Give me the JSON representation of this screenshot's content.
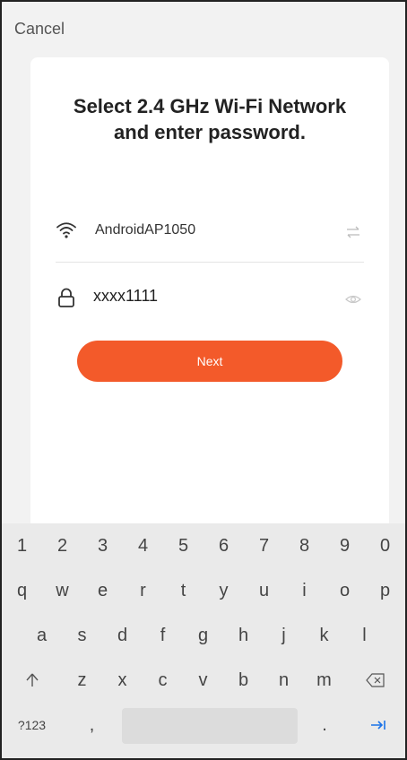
{
  "header": {
    "cancel_label": "Cancel"
  },
  "card": {
    "title": "Select 2.4 GHz Wi-Fi Network and enter password.",
    "network_name": "AndroidAP1050",
    "password_value": "xxxx1111",
    "next_label": "Next"
  },
  "colors": {
    "accent": "#f35a2a",
    "card_bg": "#ffffff",
    "keyboard_bg": "#eaeaea"
  },
  "icons": [
    "wifi-icon",
    "swap-network-icon",
    "lock-icon",
    "eye-icon",
    "shift-icon",
    "backspace-icon",
    "enter-icon"
  ],
  "keyboard": {
    "numbers": [
      "1",
      "2",
      "3",
      "4",
      "5",
      "6",
      "7",
      "8",
      "9",
      "0"
    ],
    "row1": [
      "q",
      "w",
      "e",
      "r",
      "t",
      "y",
      "u",
      "i",
      "o",
      "p"
    ],
    "row2": [
      "a",
      "s",
      "d",
      "f",
      "g",
      "h",
      "j",
      "k",
      "l"
    ],
    "row3": [
      "z",
      "x",
      "c",
      "v",
      "b",
      "n",
      "m"
    ],
    "symbols_label": "?123",
    "comma": ",",
    "period": "."
  }
}
